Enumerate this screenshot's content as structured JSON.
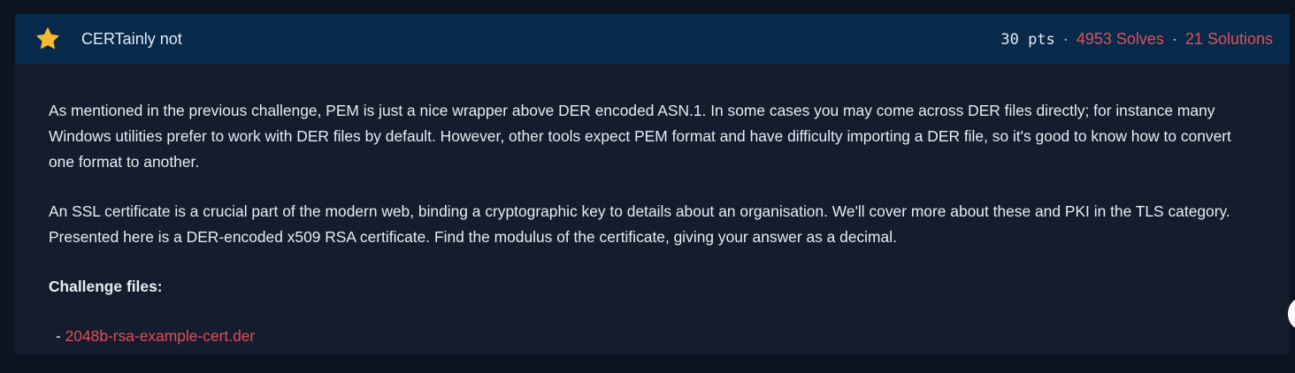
{
  "challenge": {
    "icon": "star-icon",
    "title": "CERTainly not",
    "points": "30 pts",
    "separator": "·",
    "solves": "4953 Solves",
    "solutions": "21 Solutions"
  },
  "description": {
    "paragraph_1": "As mentioned in the previous challenge, PEM is just a nice wrapper above DER encoded ASN.1. In some cases you may come across DER files directly; for instance many Windows utilities prefer to work with DER files by default. However, other tools expect PEM format and have difficulty importing a DER file, so it's good to know how to convert one format to another.",
    "paragraph_2": "An SSL certificate is a crucial part of the modern web, binding a cryptographic key to details about an organisation. We'll cover more about these and PKI in the TLS category. Presented here is a DER-encoded x509 RSA certificate. Find the modulus of the certificate, giving your answer as a decimal."
  },
  "files": {
    "heading": "Challenge files:",
    "bullet": "-",
    "items": [
      {
        "name": "2048b-rsa-example-cert.der"
      }
    ]
  },
  "colors": {
    "background": "#0d1421",
    "panel": "#141c2e",
    "header": "#07294a",
    "accent_red": "#e0505a",
    "star": "#f5b82e"
  }
}
